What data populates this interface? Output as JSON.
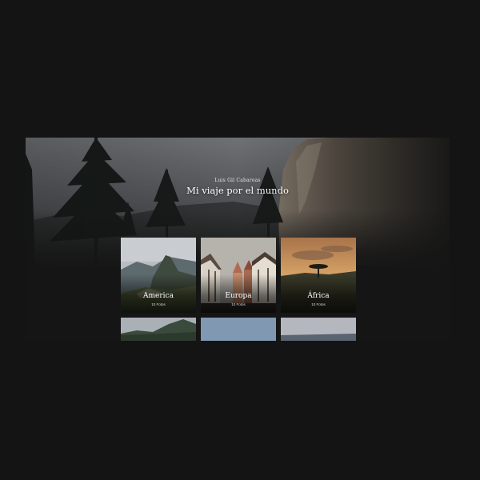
{
  "header": {
    "author": "Luis Gil Cabareas",
    "title": "Mi viaje por el mundo"
  },
  "albums": [
    {
      "name": "America",
      "count_label": "10 Fotos"
    },
    {
      "name": "Europa",
      "count_label": "10 Fotos"
    },
    {
      "name": "África",
      "count_label": "10 Fotos"
    }
  ],
  "theme": {
    "page_background": "#141414",
    "text": "#ffffff"
  }
}
